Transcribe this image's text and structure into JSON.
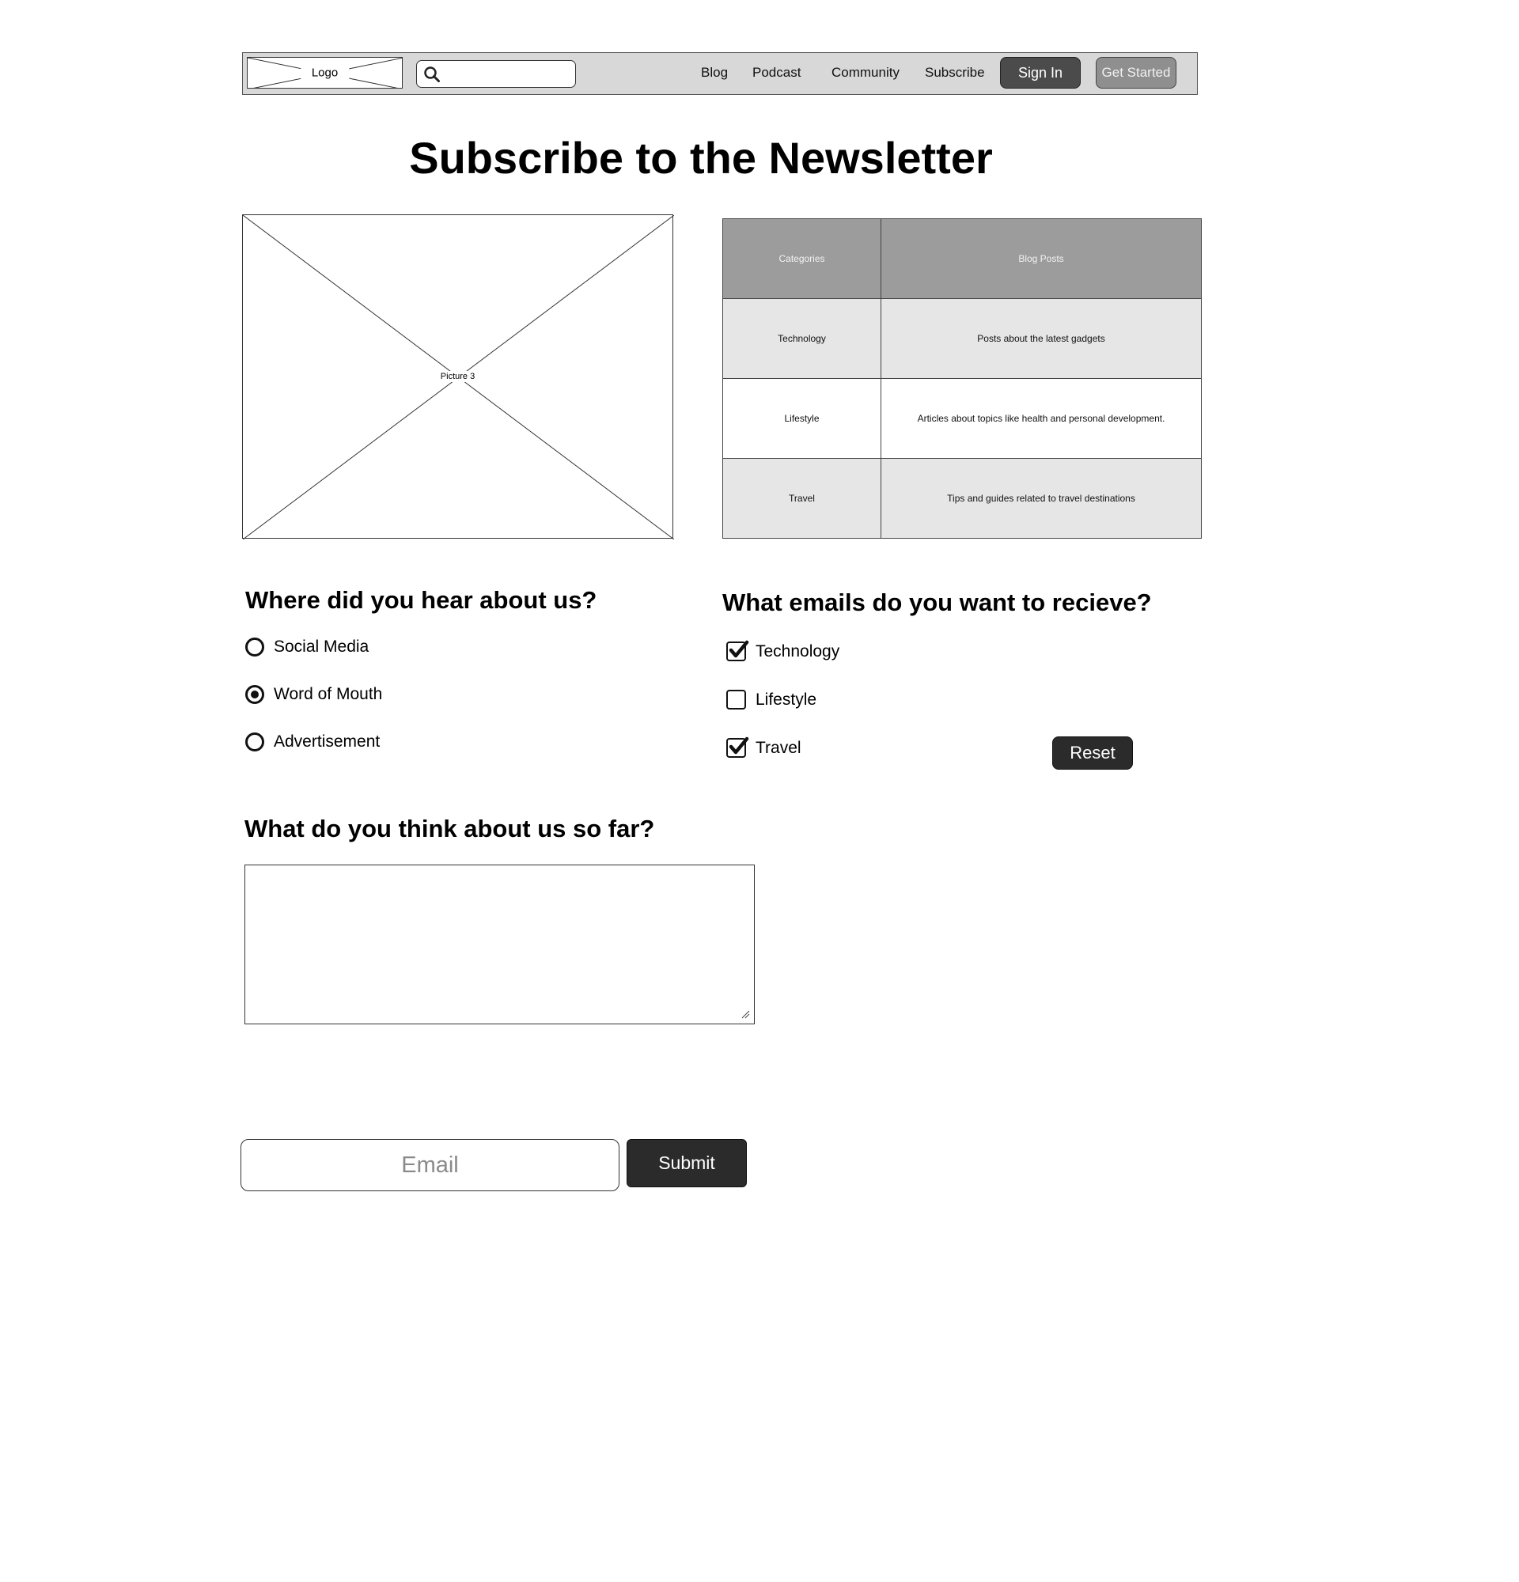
{
  "header": {
    "logo_label": "Logo",
    "search_icon": "search-icon",
    "nav": [
      "Blog",
      "Podcast",
      "Community",
      "Subscribe"
    ],
    "sign_in": "Sign In",
    "get_started": "Get Started"
  },
  "title": "Subscribe to the Newsletter",
  "picture": {
    "label": "Picture 3"
  },
  "table": {
    "headers": [
      "Categories",
      "Blog Posts"
    ],
    "rows": [
      [
        "Technology",
        "Posts about the latest gadgets"
      ],
      [
        "Lifestyle",
        "Articles about topics like health and personal development."
      ],
      [
        "Travel",
        "Tips and guides related to travel destinations"
      ]
    ]
  },
  "hear_about": {
    "heading": "Where did you hear about us?",
    "options": [
      {
        "label": "Social Media",
        "checked": false
      },
      {
        "label": "Word of Mouth",
        "checked": true
      },
      {
        "label": "Advertisement",
        "checked": false
      }
    ]
  },
  "emails": {
    "heading": "What emails do you want to recieve?",
    "options": [
      {
        "label": "Technology",
        "checked": true
      },
      {
        "label": "Lifestyle",
        "checked": false
      },
      {
        "label": "Travel",
        "checked": true
      }
    ],
    "reset": "Reset"
  },
  "feedback": {
    "heading": "What do you think about us so far?",
    "value": ""
  },
  "subscribe": {
    "email_placeholder": "Email",
    "submit": "Submit"
  }
}
